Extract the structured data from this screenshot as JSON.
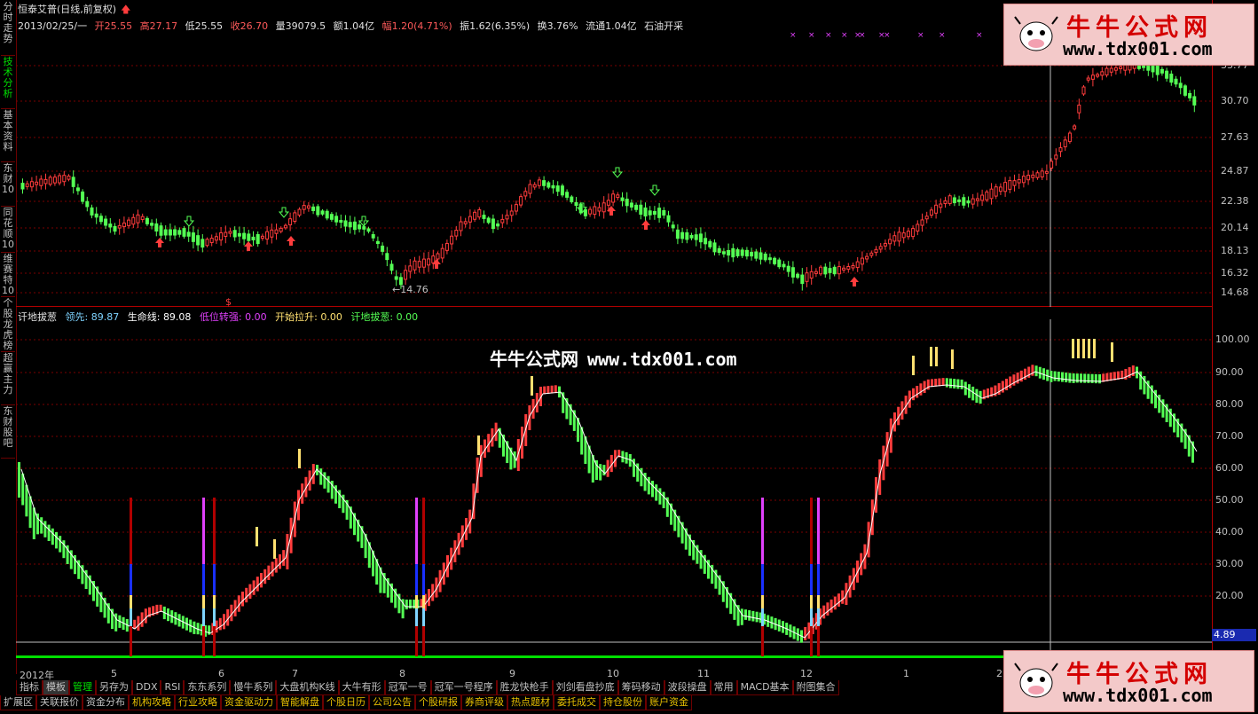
{
  "left_tabs": [
    {
      "label": "分时走势",
      "active": false
    },
    {
      "label": "技术分析",
      "active": true
    },
    {
      "label": "基本资料",
      "active": false
    },
    {
      "label": "东财10",
      "active": false
    },
    {
      "label": "同花顺10",
      "active": false
    },
    {
      "label": "维赛特10",
      "active": false
    },
    {
      "label": "个股龙虎榜",
      "active": false
    },
    {
      "label": "超赢主力",
      "active": false
    },
    {
      "label": "东财股吧",
      "active": false
    }
  ],
  "header": {
    "stock": "恒泰艾普(日线,前复权)",
    "date": "2013/02/25/一",
    "open": "开25.55",
    "high": "高27.17",
    "low": "低25.55",
    "close": "收26.70",
    "volume": "量39079.5",
    "amount": "额1.04亿",
    "change": "幅1.20(4.71%)",
    "amplitude": "振1.62(6.35%)",
    "turnover": "换3.76%",
    "float": "流通1.04亿",
    "sector": "石油开采"
  },
  "colors": {
    "up": "#ff3c3c",
    "down": "#54ff54",
    "axis": "#b00000",
    "yellow": "#ffe070",
    "magenta": "#e040fb",
    "blue": "#1a30ff",
    "cyan": "#7fd4ff",
    "white": "#ffffff"
  },
  "kline": {
    "y_ticks": [
      "33.77",
      "30.70",
      "27.63",
      "24.87",
      "22.38",
      "20.14",
      "18.13",
      "16.32",
      "14.68"
    ],
    "low_mark": "←14.76"
  },
  "indicator": {
    "name": "讦地拔葱",
    "lead_label": "领先:",
    "lead_value": "89.87",
    "life_label": "生命线:",
    "life_value": "89.08",
    "low_label": "低位转强:",
    "low_value": "0.00",
    "start_label": "开始拉升:",
    "start_value": "0.00",
    "end_label": "讦地拔葱:",
    "end_value": "0.00",
    "y_ticks": [
      "100.00",
      "90.00",
      "80.00",
      "70.00",
      "60.00",
      "50.00",
      "40.00",
      "30.00",
      "20.00"
    ],
    "current": "4.89"
  },
  "date_axis": [
    "2012年",
    "5",
    "6",
    "7",
    "8",
    "9",
    "10",
    "11",
    "12",
    "1",
    "2"
  ],
  "watermark": {
    "name": "牛牛公式网",
    "url": "www.tdx001.com"
  },
  "logo": {
    "name": "牛牛公式网",
    "url": "www.tdx001.com"
  },
  "bottom_row1": [
    "指标",
    "模板",
    "管理",
    "另存为",
    "DDX",
    "RSI",
    "东东系列",
    "慢牛系列",
    "大盘机构K线",
    "大牛有形",
    "冠军一号",
    "冠军一号程序",
    "胜龙快枪手",
    "刘剑看盘抄底",
    "筹码移动",
    "波段操盘",
    "常用",
    "MACD基本",
    "附图集合"
  ],
  "bottom_row2": [
    "扩展区",
    "关联报价",
    "资金分布",
    "机构攻略",
    "行业攻略",
    "资金驱动力",
    "智能解盘",
    "个股日历",
    "公司公告",
    "个股研报",
    "券商评级",
    "热点题材",
    "委托成交",
    "持仓股份",
    "账户资金"
  ]
}
